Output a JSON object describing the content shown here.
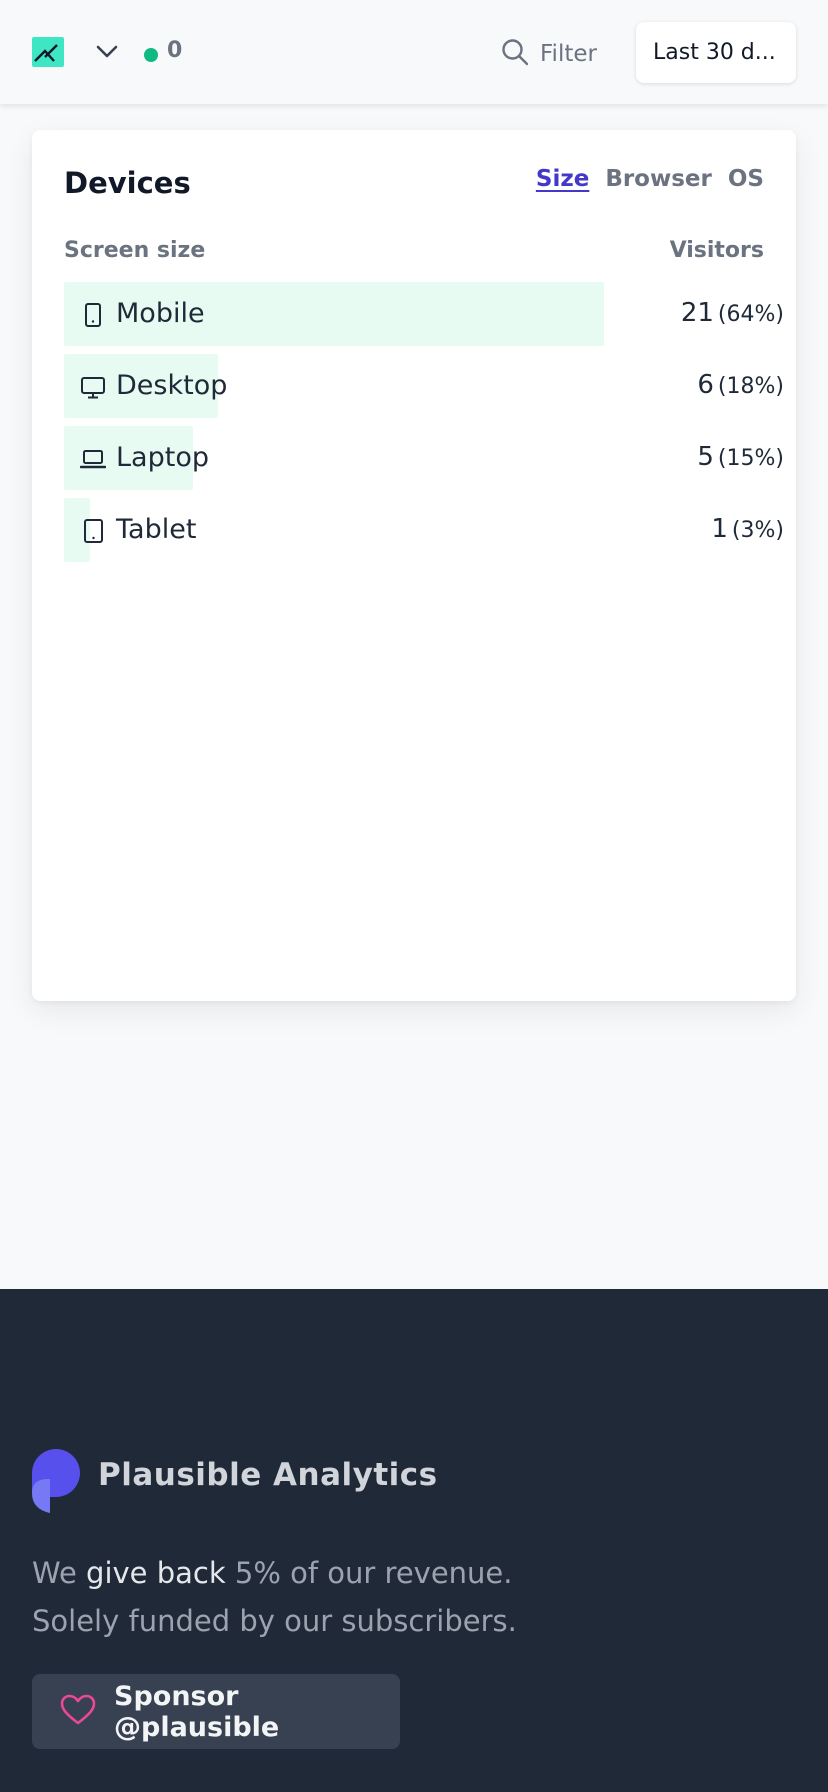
{
  "header": {
    "live_visitors": "0",
    "filter_label": "Filter",
    "date_range": "Last 30 d..."
  },
  "devices": {
    "title": "Devices",
    "tabs": [
      {
        "label": "Size",
        "active": true
      },
      {
        "label": "Browser",
        "active": false
      },
      {
        "label": "OS",
        "active": false
      }
    ],
    "col_left": "Screen size",
    "col_right": "Visitors",
    "rows": [
      {
        "label": "Mobile",
        "icon": "mobile-icon",
        "visitors": "21",
        "percent": "(64%)",
        "share": 1.0
      },
      {
        "label": "Desktop",
        "icon": "desktop-icon",
        "visitors": "6",
        "percent": "(18%)",
        "share": 0.285
      },
      {
        "label": "Laptop",
        "icon": "laptop-icon",
        "visitors": "5",
        "percent": "(15%)",
        "share": 0.238
      },
      {
        "label": "Tablet",
        "icon": "tablet-icon",
        "visitors": "1",
        "percent": "(3%)",
        "share": 0.048
      }
    ]
  },
  "footer": {
    "brand": "Plausible Analytics",
    "tagline_pre": "We ",
    "tagline_link": "give back",
    "tagline_post": " 5% of our revenue.",
    "tagline_line2": "Solely funded by our subscribers.",
    "sponsor_label": "Sponsor @plausible"
  },
  "colors": {
    "accent": "#4338ca",
    "bar": "#e8fbf2",
    "live": "#10b981",
    "logo": "#3ee6c4",
    "footer_bg": "#1f2937"
  }
}
